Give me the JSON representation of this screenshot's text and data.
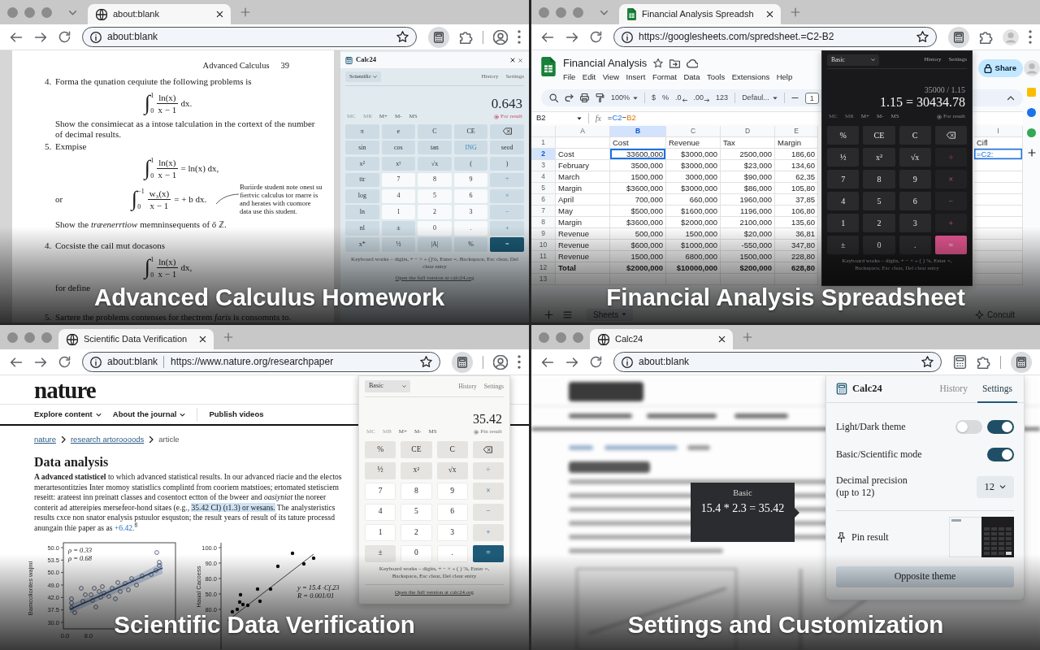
{
  "panels": [
    {
      "kind": "textbook",
      "caption": "Advanced Calculus Homework",
      "browser": {
        "tab_search_button": true,
        "tab": {
          "kind": "page",
          "title": "about:blank"
        },
        "address": [
          "about:blank"
        ],
        "toolbar_buttons": [
          {
            "kind": "calculator",
            "active": true
          },
          {
            "kind": "extensions",
            "active": false
          },
          {
            "kind": "separator"
          },
          {
            "kind": "profile",
            "active": false
          },
          {
            "kind": "menu",
            "active": false
          }
        ]
      },
      "document": {
        "running_head": "Advanced Calculus",
        "page_number": "39",
        "blocks": [
          {
            "kind": "item",
            "number": "4.",
            "text": "Forma the qunation cequiute the following problems is"
          },
          {
            "kind": "formula",
            "sign": "∫",
            "upper": "1",
            "lower": "0",
            "numerator": "ln(x)",
            "denominator": "x − 1",
            "tail": "dx."
          },
          {
            "kind": "para",
            "text": "Show the consimiecat as a intose talculation in the cortext of the number of decimal results."
          },
          {
            "kind": "item",
            "number": "5.",
            "text": "Exmpise"
          },
          {
            "kind": "formula",
            "sign": "∫",
            "upper": "1",
            "lower": "0",
            "numerator": "ln(x)",
            "denominator": "x − 1",
            "tail": "= ln(x) dx,"
          },
          {
            "kind": "formula",
            "lead": "or",
            "sign": "∫",
            "upper": "−1",
            "lower": "0",
            "numerator": "w₃(x)",
            "denominator": "x − 1",
            "tail": "= + b dx.",
            "note": "Buriirde student note onest su fiertvic calculus tor rnarre is and herates with cuomore data use this student."
          },
          {
            "kind": "para",
            "text": "Show the *træenerrtiow* memninsequents of ő ℤ."
          },
          {
            "kind": "item",
            "number": "4.",
            "text": "Cocsiste the cail mut docasons"
          },
          {
            "kind": "formula",
            "sign": "∫",
            "upper": "1",
            "lower": "0",
            "numerator": "ln(x)",
            "denominator": "x − 1",
            "tail": "dx,"
          },
          {
            "kind": "para",
            "text": "for define"
          },
          {
            "kind": "item",
            "number": "5.",
            "text": "Sartere the problems contenses for thectrem *faris* is consomnts to."
          }
        ]
      },
      "calculator": {
        "kind": "mist",
        "title": "Calc24",
        "mode": "Scientific",
        "links": [
          "History",
          "Settings"
        ],
        "display": "0.643",
        "memory": [
          {
            "label": "MC",
            "disabled": true
          },
          {
            "label": "MR",
            "disabled": true
          },
          {
            "label": "M+",
            "disabled": false
          },
          {
            "label": "M-",
            "disabled": false
          },
          {
            "label": "MS",
            "disabled": false
          }
        ],
        "pin_label": "For result",
        "keys": [
          {
            "label": "π",
            "kind": "fn"
          },
          {
            "label": "e",
            "kind": "fn"
          },
          {
            "label": "C",
            "kind": "fn"
          },
          {
            "label": "CE",
            "kind": "fn"
          },
          {
            "kind": "backspace"
          },
          {
            "label": "sin",
            "kind": "fn"
          },
          {
            "label": "cos",
            "kind": "fn"
          },
          {
            "label": "tan",
            "kind": "fn"
          },
          {
            "label": "ING",
            "kind": "accent"
          },
          {
            "label": "seod",
            "kind": "fn"
          },
          {
            "label": "x²",
            "kind": "fn"
          },
          {
            "label": "xʸ",
            "kind": "fn"
          },
          {
            "label": "√x",
            "kind": "fn"
          },
          {
            "label": "(",
            "kind": "fn"
          },
          {
            "label": ")",
            "kind": "fn"
          },
          {
            "label": "ttr",
            "kind": "fn"
          },
          {
            "label": "7",
            "kind": "num"
          },
          {
            "label": "8",
            "kind": "num"
          },
          {
            "label": "9",
            "kind": "num"
          },
          {
            "label": "÷",
            "kind": "op"
          },
          {
            "label": "log",
            "kind": "fn"
          },
          {
            "label": "4",
            "kind": "num"
          },
          {
            "label": "5",
            "kind": "num"
          },
          {
            "label": "6",
            "kind": "num"
          },
          {
            "label": "×",
            "kind": "op"
          },
          {
            "label": "ln",
            "kind": "fn"
          },
          {
            "label": "1",
            "kind": "num"
          },
          {
            "label": "2",
            "kind": "num"
          },
          {
            "label": "3",
            "kind": "num"
          },
          {
            "label": "−",
            "kind": "op"
          },
          {
            "label": "nl",
            "kind": "fn"
          },
          {
            "label": "±",
            "kind": "fn"
          },
          {
            "label": "0",
            "kind": "num"
          },
          {
            "label": ".",
            "kind": "num"
          },
          {
            "label": "+",
            "kind": "op"
          },
          {
            "label": "x*",
            "kind": "fn"
          },
          {
            "label": "½",
            "kind": "fn"
          },
          {
            "label": "|A|",
            "kind": "fn"
          },
          {
            "label": "%",
            "kind": "fn"
          },
          {
            "label": "=",
            "kind": "eq"
          }
        ],
        "footer": "Keyboard works – digits, + − × ÷ ()%, Enter =, Backspace, Esc clear, Del clear entry",
        "link": "Open the full version at calc24.org"
      }
    },
    {
      "kind": "spreadsheet",
      "caption": "Financial Analysis Spreadsheet",
      "browser": {
        "tab_search_button": true,
        "tab": {
          "kind": "sheets",
          "title": "Financial Analysis Spreadsh"
        },
        "address": [
          "https://googlesheets.com/spredsheet.=C2-B2"
        ],
        "toolbar_buttons": [
          {
            "kind": "calculator",
            "active": true
          },
          {
            "kind": "extensions",
            "active": false
          },
          {
            "kind": "avatar",
            "active": false
          },
          {
            "kind": "menu",
            "active": false
          }
        ]
      },
      "sheet": {
        "title": "Financial Analysis",
        "menu": [
          "File",
          "Edit",
          "View",
          "Insert",
          "Format",
          "Data",
          "Tools",
          "Extensions",
          "Help"
        ],
        "share": "Share",
        "zoom": "100%",
        "format_buttons": [
          {
            "label": "$",
            "kind": "text"
          },
          {
            "label": "%",
            "kind": "text"
          },
          {
            "label": ".0",
            "kind": "decimal-down"
          },
          {
            "label": ".00",
            "kind": "decimal-up"
          },
          {
            "label": "123",
            "kind": "text"
          }
        ],
        "font": "Defaul...",
        "font_size": "1",
        "name_box": "B2",
        "formula_label": "fx",
        "formula": [
          {
            "text": "="
          },
          {
            "text": "C2",
            "kind": "ref"
          },
          {
            "text": "−"
          },
          {
            "text": "B2",
            "kind": "ref"
          }
        ],
        "columns": [
          {
            "label": "A",
            "selected": false
          },
          {
            "label": "B",
            "selected": true
          },
          {
            "label": "C",
            "selected": false
          },
          {
            "label": "D",
            "selected": false
          },
          {
            "label": "E",
            "selected": false
          }
        ],
        "far_column": {
          "label": "I",
          "cells": [
            {
              "text": "Cifl",
              "editing": false
            },
            {
              "text": "=C2:",
              "editing": true
            }
          ]
        },
        "rows": [
          {
            "number": "1",
            "kind": "header",
            "selected": false,
            "cells": [
              "Cost",
              "Revenue",
              "Tax",
              "Margin"
            ]
          },
          {
            "number": "2",
            "kind": "data",
            "selected": true,
            "cells": [
              "Cost",
              "33600,000",
              "$3000,000",
              "2500,000",
              "186,60"
            ]
          },
          {
            "number": "3",
            "kind": "data",
            "selected": false,
            "cells": [
              "February",
              "3500,000",
              "$3000,000",
              "$23,000",
              "134,60"
            ]
          },
          {
            "number": "4",
            "kind": "data",
            "selected": false,
            "cells": [
              "March",
              "1500,000",
              "3000,000",
              "$90,000",
              "62,35"
            ]
          },
          {
            "number": "5",
            "kind": "data",
            "selected": false,
            "cells": [
              "Margin",
              "$3600,000",
              "$3000,000",
              "$86,000",
              "105,80"
            ]
          },
          {
            "number": "6",
            "kind": "data",
            "selected": false,
            "cells": [
              "April",
              "700,000",
              "660,000",
              "1960,000",
              "37,85"
            ]
          },
          {
            "number": "7",
            "kind": "data",
            "selected": false,
            "cells": [
              "May",
              "$500,000",
              "$1600,000",
              "1196,000",
              "106,80"
            ]
          },
          {
            "number": "8",
            "kind": "data",
            "selected": false,
            "cells": [
              "Margin",
              "$3600,000",
              "$2000,000",
              "2100,000",
              "135,60"
            ]
          },
          {
            "number": "9",
            "kind": "data",
            "selected": false,
            "cells": [
              "Revenue",
              "500,000",
              "1500,000",
              "$20,000",
              "36,81"
            ]
          },
          {
            "number": "10",
            "kind": "data",
            "selected": false,
            "cells": [
              "Revenue",
              "$600,000",
              "$1000,000",
              "-550,000",
              "347,80"
            ]
          },
          {
            "number": "11",
            "kind": "data",
            "selected": false,
            "cells": [
              "Revenue",
              "1500,000",
              "6800,000",
              "1500,000",
              "228,80"
            ]
          },
          {
            "number": "12",
            "kind": "total",
            "selected": false,
            "cells": [
              "Total",
              "$2000,000",
              "$10000,000",
              "$200,000",
              "628,80"
            ]
          },
          {
            "number": "13",
            "kind": "data",
            "selected": false
          }
        ],
        "sheet_tab": "Sheets",
        "explore": "Concult"
      },
      "calculator": {
        "kind": "dark",
        "mode": "Basic",
        "links": [
          "History",
          "Settings"
        ],
        "expression": "35000 / 1.15",
        "display": "1.15 = 30434.78",
        "memory": [
          {
            "label": "MC",
            "disabled": true
          },
          {
            "label": "MR",
            "disabled": true
          },
          {
            "label": "M+",
            "disabled": false
          },
          {
            "label": "M-",
            "disabled": false
          },
          {
            "label": "MS",
            "disabled": false
          }
        ],
        "pin_label": "For result",
        "keys": [
          {
            "label": "%",
            "kind": "fn"
          },
          {
            "label": "CE",
            "kind": "fn"
          },
          {
            "label": "C",
            "kind": "fn"
          },
          {
            "kind": "backspace"
          },
          {
            "label": "½",
            "kind": "fn"
          },
          {
            "label": "x²",
            "kind": "fn"
          },
          {
            "label": "√x",
            "kind": "fn"
          },
          {
            "label": "÷",
            "kind": "op"
          },
          {
            "label": "7",
            "kind": "num"
          },
          {
            "label": "8",
            "kind": "num"
          },
          {
            "label": "9",
            "kind": "num"
          },
          {
            "label": "×",
            "kind": "op"
          },
          {
            "label": "4",
            "kind": "num"
          },
          {
            "label": "5",
            "kind": "num"
          },
          {
            "label": "6",
            "kind": "num"
          },
          {
            "label": "−",
            "kind": "op"
          },
          {
            "label": "1",
            "kind": "num"
          },
          {
            "label": "2",
            "kind": "num"
          },
          {
            "label": "3",
            "kind": "num"
          },
          {
            "label": "+",
            "kind": "op"
          },
          {
            "label": "±",
            "kind": "fn"
          },
          {
            "label": "0",
            "kind": "num"
          },
          {
            "label": ".",
            "kind": "num"
          },
          {
            "label": "=",
            "kind": "eq"
          }
        ],
        "footer": "Keyboard works – digits, + − × ÷ ( ) %, Enter =, Backspace, Esc clear, Del clear entry"
      }
    },
    {
      "kind": "article",
      "caption": "Scientific Data Verification",
      "browser": {
        "tab": {
          "kind": "page",
          "title": "Scientific Data Verification"
        },
        "address": [
          "about:blank",
          "https://www.nature.org/researchpaper"
        ],
        "toolbar_buttons": [
          {
            "kind": "calculator",
            "active": true
          },
          {
            "kind": "separator"
          },
          {
            "kind": "profile",
            "active": false
          },
          {
            "kind": "menu",
            "active": false
          }
        ]
      },
      "article": {
        "logo": "nature",
        "nav": [
          {
            "label": "Explore content",
            "dropdown": true
          },
          {
            "label": "About the journal",
            "dropdown": true
          },
          {
            "label": "Publish videos"
          }
        ],
        "breadcrumb": [
          {
            "label": "nature",
            "link": true
          },
          {
            "label": "research artoroooods",
            "link": true
          },
          {
            "label": "article"
          }
        ],
        "heading": "Data analysis",
        "paragraph": [
          {
            "kind": "plain",
            "text": "**A advanced statisticel** to which advanced statistical results. In our advanced riacie and the electos merartesontitzies Inter momoy statistlics complintd from cooriem matstioes; ertomated stetisciem reseitt: arateest inn preinatt classes and cosentoct ectton of the bweer and *oasiyniat* the noreer conterit ad attereipies mersefeor-hond sitaes (e.g., "
          },
          {
            "kind": "highlight",
            "text": "35.42 CI) (ɪ1.3) or wesans."
          },
          {
            "kind": "plain",
            "text": " The analysteristics results cxce non snator enalysis pstuulor esquston; the result years of result of its tature processd anungain thie paper as as "
          },
          {
            "kind": "link",
            "text": "+6.42."
          },
          {
            "kind": "plain",
            "text": "$^{8}$"
          }
        ],
        "figures": [
          {
            "kind": "band-scatter",
            "y_label": "Bamcoliontes wajmi",
            "y_ticks": [
              "50.0",
              "53.5",
              "50.0",
              "49.0",
              "42.0",
              "37.5",
              "30.0"
            ],
            "x_ticks": [
              "0.0",
              "8.0"
            ],
            "annotations": [
              "ρ = 0.33",
              "ρ = 0.68"
            ]
          },
          {
            "kind": "dot-scatter",
            "y_label": "Haual Cacoess",
            "y_ticks": [
              "100.0",
              "90.0",
              "80.0",
              "50.0",
              "80.0"
            ],
            "annotations": [
              "y = 15.4 ·Cf.23",
              "R = 0.001/01"
            ]
          }
        ]
      },
      "calculator": {
        "kind": "light",
        "mode": "Basic",
        "links": [
          "History",
          "Settings"
        ],
        "display": "35.42",
        "memory": [
          {
            "label": "MC",
            "disabled": true
          },
          {
            "label": "MB",
            "disabled": true
          },
          {
            "label": "M+",
            "disabled": false
          },
          {
            "label": "M-",
            "disabled": false
          },
          {
            "label": "MS",
            "disabled": false
          }
        ],
        "pin_label": "Pin result",
        "keys": [
          {
            "label": "%",
            "kind": "fn"
          },
          {
            "label": "CE",
            "kind": "fn"
          },
          {
            "label": "C",
            "kind": "fn"
          },
          {
            "kind": "backspace"
          },
          {
            "label": "½",
            "kind": "fn"
          },
          {
            "label": "x²",
            "kind": "fn"
          },
          {
            "label": "√x",
            "kind": "fn"
          },
          {
            "label": "÷",
            "kind": "op"
          },
          {
            "label": "7",
            "kind": "num"
          },
          {
            "label": "8",
            "kind": "num"
          },
          {
            "label": "9",
            "kind": "num"
          },
          {
            "label": "×",
            "kind": "op"
          },
          {
            "label": "4",
            "kind": "num"
          },
          {
            "label": "5",
            "kind": "num"
          },
          {
            "label": "6",
            "kind": "num"
          },
          {
            "label": "−",
            "kind": "op"
          },
          {
            "label": "1",
            "kind": "num"
          },
          {
            "label": "2",
            "kind": "num"
          },
          {
            "label": "3",
            "kind": "num"
          },
          {
            "label": "+",
            "kind": "op"
          },
          {
            "label": "±",
            "kind": "fn"
          },
          {
            "label": "0",
            "kind": "num"
          },
          {
            "label": ".",
            "kind": "num"
          },
          {
            "label": "=",
            "kind": "eq"
          }
        ],
        "footer": "Keyboard works – digits, + − × ÷ ( ) %, Enter =, Backspace, Esc clear, Del clear entry",
        "link": "Open the full version at calc24.org"
      }
    },
    {
      "kind": "settings",
      "caption": "Settings and Customization",
      "browser": {
        "tab": {
          "kind": "page",
          "title": "Calc24"
        },
        "address": [
          "about:blank"
        ],
        "toolbar_buttons": [
          {
            "kind": "calculator",
            "active": false
          },
          {
            "kind": "extensions",
            "active": false
          },
          {
            "kind": "separator"
          },
          {
            "kind": "calculator",
            "active": true
          }
        ]
      },
      "tooltip": {
        "mode": "Basic",
        "expression": "15.4 * 2.3 = 35.42"
      },
      "settings": {
        "title": "Calc24",
        "tabs": [
          {
            "label": "History",
            "selected": false
          },
          {
            "label": "Settings",
            "selected": true
          }
        ],
        "rows": [
          {
            "kind": "toggles",
            "label": "Light/Dark theme",
            "toggles": [
              {
                "on": false
              },
              {
                "on": true
              }
            ]
          },
          {
            "kind": "toggles",
            "label": "Basic/Scientific mode",
            "toggles": [
              {
                "on": true
              }
            ]
          },
          {
            "kind": "select",
            "label": "Decimal precision (up to 12)",
            "value": "12"
          },
          {
            "kind": "pin",
            "label": "Pin result"
          }
        ],
        "button": "Opposite theme"
      }
    }
  ]
}
